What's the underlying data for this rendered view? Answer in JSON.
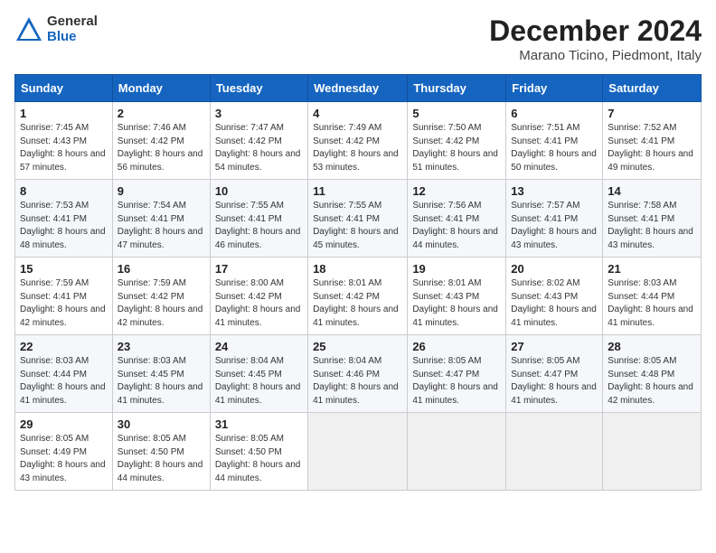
{
  "header": {
    "logo_general": "General",
    "logo_blue": "Blue",
    "month_year": "December 2024",
    "location": "Marano Ticino, Piedmont, Italy"
  },
  "days_of_week": [
    "Sunday",
    "Monday",
    "Tuesday",
    "Wednesday",
    "Thursday",
    "Friday",
    "Saturday"
  ],
  "weeks": [
    [
      {
        "day": "1",
        "info": "Sunrise: 7:45 AM\nSunset: 4:43 PM\nDaylight: 8 hours and 57 minutes."
      },
      {
        "day": "2",
        "info": "Sunrise: 7:46 AM\nSunset: 4:42 PM\nDaylight: 8 hours and 56 minutes."
      },
      {
        "day": "3",
        "info": "Sunrise: 7:47 AM\nSunset: 4:42 PM\nDaylight: 8 hours and 54 minutes."
      },
      {
        "day": "4",
        "info": "Sunrise: 7:49 AM\nSunset: 4:42 PM\nDaylight: 8 hours and 53 minutes."
      },
      {
        "day": "5",
        "info": "Sunrise: 7:50 AM\nSunset: 4:42 PM\nDaylight: 8 hours and 51 minutes."
      },
      {
        "day": "6",
        "info": "Sunrise: 7:51 AM\nSunset: 4:41 PM\nDaylight: 8 hours and 50 minutes."
      },
      {
        "day": "7",
        "info": "Sunrise: 7:52 AM\nSunset: 4:41 PM\nDaylight: 8 hours and 49 minutes."
      }
    ],
    [
      {
        "day": "8",
        "info": "Sunrise: 7:53 AM\nSunset: 4:41 PM\nDaylight: 8 hours and 48 minutes."
      },
      {
        "day": "9",
        "info": "Sunrise: 7:54 AM\nSunset: 4:41 PM\nDaylight: 8 hours and 47 minutes."
      },
      {
        "day": "10",
        "info": "Sunrise: 7:55 AM\nSunset: 4:41 PM\nDaylight: 8 hours and 46 minutes."
      },
      {
        "day": "11",
        "info": "Sunrise: 7:55 AM\nSunset: 4:41 PM\nDaylight: 8 hours and 45 minutes."
      },
      {
        "day": "12",
        "info": "Sunrise: 7:56 AM\nSunset: 4:41 PM\nDaylight: 8 hours and 44 minutes."
      },
      {
        "day": "13",
        "info": "Sunrise: 7:57 AM\nSunset: 4:41 PM\nDaylight: 8 hours and 43 minutes."
      },
      {
        "day": "14",
        "info": "Sunrise: 7:58 AM\nSunset: 4:41 PM\nDaylight: 8 hours and 43 minutes."
      }
    ],
    [
      {
        "day": "15",
        "info": "Sunrise: 7:59 AM\nSunset: 4:41 PM\nDaylight: 8 hours and 42 minutes."
      },
      {
        "day": "16",
        "info": "Sunrise: 7:59 AM\nSunset: 4:42 PM\nDaylight: 8 hours and 42 minutes."
      },
      {
        "day": "17",
        "info": "Sunrise: 8:00 AM\nSunset: 4:42 PM\nDaylight: 8 hours and 41 minutes."
      },
      {
        "day": "18",
        "info": "Sunrise: 8:01 AM\nSunset: 4:42 PM\nDaylight: 8 hours and 41 minutes."
      },
      {
        "day": "19",
        "info": "Sunrise: 8:01 AM\nSunset: 4:43 PM\nDaylight: 8 hours and 41 minutes."
      },
      {
        "day": "20",
        "info": "Sunrise: 8:02 AM\nSunset: 4:43 PM\nDaylight: 8 hours and 41 minutes."
      },
      {
        "day": "21",
        "info": "Sunrise: 8:03 AM\nSunset: 4:44 PM\nDaylight: 8 hours and 41 minutes."
      }
    ],
    [
      {
        "day": "22",
        "info": "Sunrise: 8:03 AM\nSunset: 4:44 PM\nDaylight: 8 hours and 41 minutes."
      },
      {
        "day": "23",
        "info": "Sunrise: 8:03 AM\nSunset: 4:45 PM\nDaylight: 8 hours and 41 minutes."
      },
      {
        "day": "24",
        "info": "Sunrise: 8:04 AM\nSunset: 4:45 PM\nDaylight: 8 hours and 41 minutes."
      },
      {
        "day": "25",
        "info": "Sunrise: 8:04 AM\nSunset: 4:46 PM\nDaylight: 8 hours and 41 minutes."
      },
      {
        "day": "26",
        "info": "Sunrise: 8:05 AM\nSunset: 4:47 PM\nDaylight: 8 hours and 41 minutes."
      },
      {
        "day": "27",
        "info": "Sunrise: 8:05 AM\nSunset: 4:47 PM\nDaylight: 8 hours and 41 minutes."
      },
      {
        "day": "28",
        "info": "Sunrise: 8:05 AM\nSunset: 4:48 PM\nDaylight: 8 hours and 42 minutes."
      }
    ],
    [
      {
        "day": "29",
        "info": "Sunrise: 8:05 AM\nSunset: 4:49 PM\nDaylight: 8 hours and 43 minutes."
      },
      {
        "day": "30",
        "info": "Sunrise: 8:05 AM\nSunset: 4:50 PM\nDaylight: 8 hours and 44 minutes."
      },
      {
        "day": "31",
        "info": "Sunrise: 8:05 AM\nSunset: 4:50 PM\nDaylight: 8 hours and 44 minutes."
      },
      null,
      null,
      null,
      null
    ]
  ]
}
